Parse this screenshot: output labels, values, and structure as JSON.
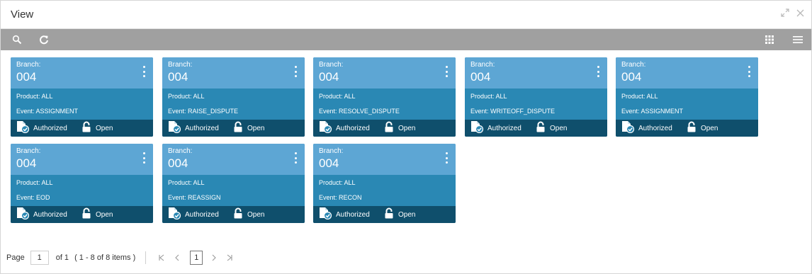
{
  "window": {
    "title": "View",
    "restore_icon": "restore-icon",
    "close_icon": "close-icon"
  },
  "toolbar": {
    "search_icon": "search-icon",
    "refresh_icon": "refresh-icon",
    "grid_view_icon": "grid-view-icon",
    "list_view_icon": "list-view-icon"
  },
  "colors": {
    "tile_header": "#5da6d4",
    "tile_body": "#2a88b4",
    "tile_footer": "#0f4f6c",
    "toolbar": "#a0a0a0"
  },
  "tiles": [
    {
      "branch_label": "Branch:",
      "branch": "004",
      "product": "Product: ALL",
      "event": "Event: ASSIGNMENT",
      "auth_status": "Authorized",
      "record_status": "Open"
    },
    {
      "branch_label": "Branch:",
      "branch": "004",
      "product": "Product: ALL",
      "event": "Event: RAISE_DISPUTE",
      "auth_status": "Authorized",
      "record_status": "Open"
    },
    {
      "branch_label": "Branch:",
      "branch": "004",
      "product": "Product: ALL",
      "event": "Event: RESOLVE_DISPUTE",
      "auth_status": "Authorized",
      "record_status": "Open"
    },
    {
      "branch_label": "Branch:",
      "branch": "004",
      "product": "Product: ALL",
      "event": "Event: WRITEOFF_DISPUTE",
      "auth_status": "Authorized",
      "record_status": "Open"
    },
    {
      "branch_label": "Branch:",
      "branch": "004",
      "product": "Product: ALL",
      "event": "Event: ASSIGNMENT",
      "auth_status": "Authorized",
      "record_status": "Open"
    },
    {
      "branch_label": "Branch:",
      "branch": "004",
      "product": "Product: ALL",
      "event": "Event: EOD",
      "auth_status": "Authorized",
      "record_status": "Open"
    },
    {
      "branch_label": "Branch:",
      "branch": "004",
      "product": "Product: ALL",
      "event": "Event: REASSIGN",
      "auth_status": "Authorized",
      "record_status": "Open"
    },
    {
      "branch_label": "Branch:",
      "branch": "004",
      "product": "Product: ALL",
      "event": "Event: RECON",
      "auth_status": "Authorized",
      "record_status": "Open"
    }
  ],
  "pagination": {
    "page_label": "Page",
    "page_value": "1",
    "of_text": "of 1",
    "range_text": "( 1 - 8 of 8 items )",
    "current_page": "1",
    "first_glyph": "K",
    "prev_glyph": "<",
    "next_glyph": ">",
    "last_glyph": ">|"
  }
}
